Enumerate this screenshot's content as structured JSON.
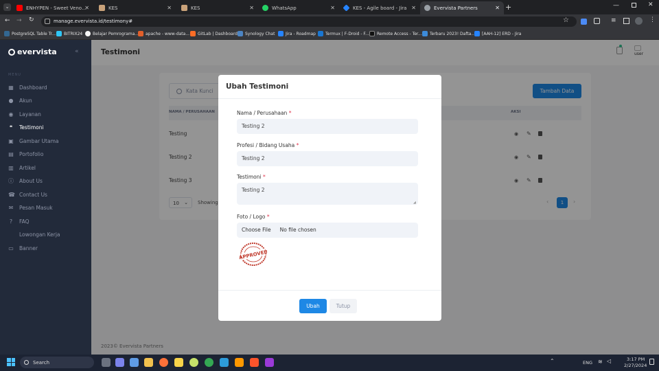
{
  "browser": {
    "tabs": [
      {
        "title": "ENHYPEN - Sweet Venom | Pia",
        "color": "#ff0000"
      },
      {
        "title": "KES",
        "color": "#c9a27a"
      },
      {
        "title": "KES",
        "color": "#c9a27a"
      },
      {
        "title": "WhatsApp",
        "color": "#25d366"
      },
      {
        "title": "KES - Agile board - Jira",
        "color": "#2684ff"
      },
      {
        "title": "Evervista Partners",
        "color": "#9aa0a6"
      }
    ],
    "url": "manage.evervista.id/testimony#",
    "bookmarks": [
      {
        "label": "PostgreSQL Table Tr...",
        "color": "#336791"
      },
      {
        "label": "BITRIX24",
        "color": "#2fc6f6"
      },
      {
        "label": "Belajar Pemrograma...",
        "color": "#f5f5f5"
      },
      {
        "label": "apache - www-data...",
        "color": "#e25f2a"
      },
      {
        "label": "GitLab | Dashboard",
        "color": "#fc6d26"
      },
      {
        "label": "Synology Chat",
        "color": "#4c84c3"
      },
      {
        "label": "Jira - Roadmap",
        "color": "#2684ff"
      },
      {
        "label": "Termux | F-Droid - F...",
        "color": "#1976d2"
      },
      {
        "label": "Remote Access - Ter...",
        "color": "#111111"
      },
      {
        "label": "Terbaru 2023! Dafta...",
        "color": "#3d8bd9"
      },
      {
        "label": "[AAH-12] ERD - Jira",
        "color": "#2684ff"
      }
    ]
  },
  "app": {
    "brand": "evervista",
    "page_title": "Testimoni",
    "menu_heading": "MENU",
    "user_label": "user",
    "footer": "2023© Evervista Partners",
    "sidebar": [
      {
        "label": "Dashboard",
        "icon": "dashboard-icon"
      },
      {
        "label": "Akun",
        "icon": "user-icon"
      },
      {
        "label": "Layanan",
        "icon": "eye-icon"
      },
      {
        "label": "Testimoni",
        "icon": "quote-icon",
        "active": true
      },
      {
        "label": "Gambar Utama",
        "icon": "image-icon"
      },
      {
        "label": "Portofolio",
        "icon": "folder-icon"
      },
      {
        "label": "Artikel",
        "icon": "article-icon"
      },
      {
        "label": "About Us",
        "icon": "info-icon"
      },
      {
        "label": "Contact Us",
        "icon": "phone-icon"
      },
      {
        "label": "Pesan Masuk",
        "icon": "mail-icon"
      },
      {
        "label": "FAQ",
        "icon": "help-icon"
      },
      {
        "label": "Lowongan Kerja",
        "icon": "briefcase-icon"
      },
      {
        "label": "Banner",
        "icon": "banner-icon"
      }
    ],
    "search_placeholder": "Kata Kunci",
    "add_button": "Tambah Data",
    "table": {
      "headers": [
        "NAMA / PERUSAHAAN",
        "AKSI"
      ],
      "rows": [
        "Testing",
        "Testing 2",
        "Testing 3"
      ]
    },
    "page_size": "10",
    "showing_text": "Showing",
    "current_page": "1"
  },
  "modal": {
    "title": "Ubah Testimoni",
    "fields": {
      "name_label": "Nama / Perusahaan",
      "name_value": "Testing 2",
      "profession_label": "Profesi / Bidang Usaha",
      "profession_value": "Testing 2",
      "testimony_label": "Testimoni",
      "testimony_value": "Testing 2",
      "logo_label": "Foto / Logo",
      "choose_file": "Choose File",
      "no_file": "No file chosen",
      "required_mark": "*"
    },
    "stamp_text": "APPROVED",
    "submit_button": "Ubah",
    "close_button": "Tutup"
  },
  "taskbar": {
    "search": "Search",
    "lang": "ENG",
    "time": "3:17 PM",
    "date": "2/27/2024"
  },
  "colors": {
    "accent": "#1e88e5",
    "sidebar_bg": "#222a3a",
    "required": "#e0344c"
  }
}
